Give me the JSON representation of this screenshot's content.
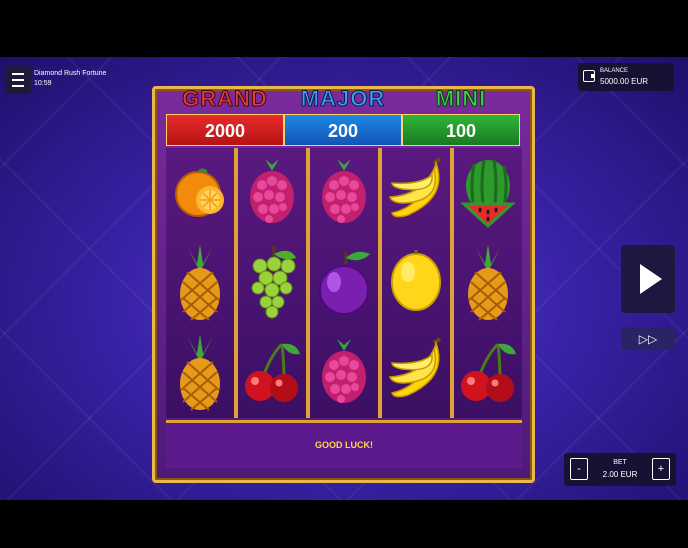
{
  "header": {
    "game_title": "Diamond Rush Fortune",
    "time": "10:59",
    "balance_label": "BALANCE",
    "balance_value": "5000.00 EUR"
  },
  "jackpots": [
    {
      "name": "GRAND",
      "value": "2000"
    },
    {
      "name": "MAJOR",
      "value": "200"
    },
    {
      "name": "MINI",
      "value": "100"
    }
  ],
  "reels": [
    [
      "orange",
      "pineapple",
      "pineapple"
    ],
    [
      "raspberry",
      "grapes",
      "cherry"
    ],
    [
      "raspberry",
      "plum",
      "raspberry"
    ],
    [
      "banana",
      "lemon",
      "banana"
    ],
    [
      "watermelon",
      "pineapple",
      "cherry"
    ]
  ],
  "message": "GOOD LUCK!",
  "controls": {
    "spin_icon": "play-icon",
    "turbo_icon": "fast-forward-icon",
    "bet_label": "BET",
    "bet_value": "2.00 EUR",
    "bet_minus": "-",
    "bet_plus": "+"
  }
}
